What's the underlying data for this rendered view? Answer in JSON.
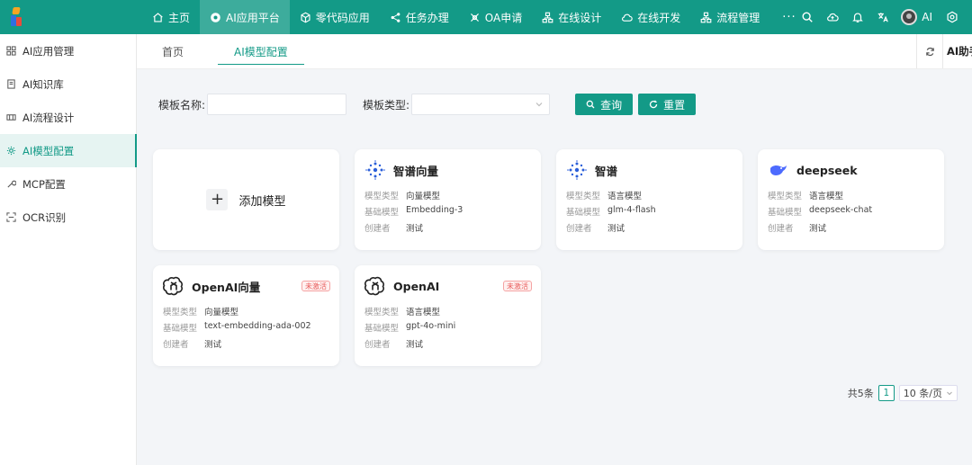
{
  "nav": {
    "items": [
      {
        "label": "主页",
        "icon": "home-icon"
      },
      {
        "label": "AI应用平台",
        "icon": "ai-platform-icon"
      },
      {
        "label": "零代码应用",
        "icon": "nocode-icon"
      },
      {
        "label": "任务办理",
        "icon": "share-icon"
      },
      {
        "label": "OA申请",
        "icon": "oa-icon"
      },
      {
        "label": "在线设计",
        "icon": "org-chart-icon"
      },
      {
        "label": "在线开发",
        "icon": "cloud-icon"
      },
      {
        "label": "流程管理",
        "icon": "flow-icon"
      }
    ],
    "more": "···",
    "user_name": "AI"
  },
  "sidebar": {
    "items": [
      {
        "label": "AI应用管理",
        "icon": "grid-icon"
      },
      {
        "label": "AI知识库",
        "icon": "book-icon"
      },
      {
        "label": "AI流程设计",
        "icon": "process-icon"
      },
      {
        "label": "AI模型配置",
        "icon": "gear-icon"
      },
      {
        "label": "MCP配置",
        "icon": "wrench-icon"
      },
      {
        "label": "OCR识别",
        "icon": "scan-icon"
      }
    ]
  },
  "tabs": [
    {
      "label": "首页"
    },
    {
      "label": "AI模型配置"
    }
  ],
  "helper_label": "AI助手",
  "search": {
    "name_label": "模板名称:",
    "name_value": "",
    "type_label": "模板类型:",
    "type_value": "",
    "query_label": "查询",
    "reset_label": "重置"
  },
  "add_card": {
    "label": "添加模型"
  },
  "meta_labels": {
    "type": "模型类型",
    "base": "基础模型",
    "creator": "创建者"
  },
  "cards": [
    {
      "name": "智谱向量",
      "logo": "zhipu-logo-icon",
      "type": "向量模型",
      "base": "Embedding-3",
      "creator": "测试",
      "badge": ""
    },
    {
      "name": "智谱",
      "logo": "zhipu-logo-icon",
      "type": "语言模型",
      "base": "glm-4-flash",
      "creator": "测试",
      "badge": ""
    },
    {
      "name": "deepseek",
      "logo": "deepseek-logo-icon",
      "type": "语言模型",
      "base": "deepseek-chat",
      "creator": "测试",
      "badge": ""
    },
    {
      "name": "OpenAI向量",
      "logo": "openai-logo-icon",
      "type": "向量模型",
      "base": "text-embedding-ada-002",
      "creator": "测试",
      "badge": "未激活"
    },
    {
      "name": "OpenAI",
      "logo": "openai-logo-icon",
      "type": "语言模型",
      "base": "gpt-4o-mini",
      "creator": "测试",
      "badge": "未激活"
    }
  ],
  "pagination": {
    "total": "共5条",
    "page": "1",
    "page_size": "10 条/页"
  },
  "colors": {
    "accent": "#139a87",
    "badge": "#e85a5a"
  }
}
